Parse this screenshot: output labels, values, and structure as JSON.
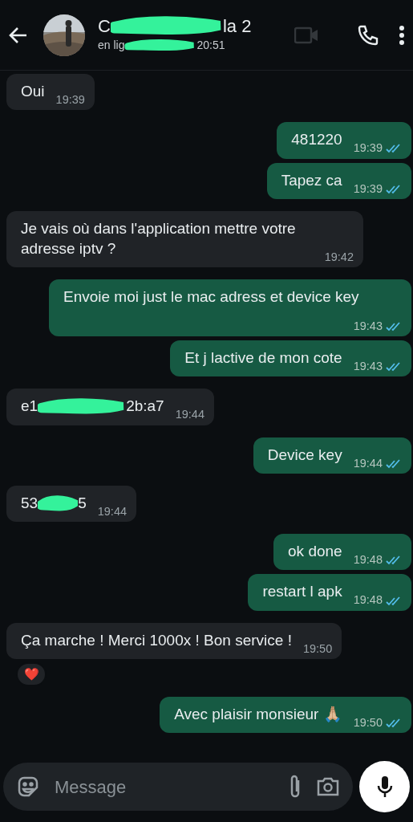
{
  "header": {
    "name_start": "C",
    "name_end": "la 2",
    "status_start": "en lig",
    "status_end": "20:51",
    "video_call_disabled": true
  },
  "messages": [
    {
      "outgoing": false,
      "text": "Oui",
      "time": "19:39"
    },
    {
      "outgoing": true,
      "text": "481220",
      "time": "19:39",
      "read": true
    },
    {
      "outgoing": true,
      "text": "Tapez ca",
      "time": "19:39",
      "read": true
    },
    {
      "outgoing": false,
      "text": "Je vais où dans l'application mettre votre adresse iptv ?",
      "time": "19:42"
    },
    {
      "outgoing": true,
      "text": "Envoie moi just le mac adress et device key",
      "time": "19:43",
      "read": true
    },
    {
      "outgoing": true,
      "text": "Et j lactive de mon cote",
      "time": "19:43",
      "read": true
    },
    {
      "outgoing": false,
      "text": "e1",
      "text_end": "2b:a7",
      "redacted": true,
      "time": "19:44"
    },
    {
      "outgoing": true,
      "text": "Device key",
      "time": "19:44",
      "read": true
    },
    {
      "outgoing": false,
      "text": "53",
      "text_end": "5",
      "redacted": true,
      "time": "19:44"
    },
    {
      "outgoing": true,
      "text": "ok done",
      "time": "19:48",
      "read": true
    },
    {
      "outgoing": true,
      "text": "restart l apk",
      "time": "19:48",
      "read": true
    },
    {
      "outgoing": false,
      "text": "Ça marche ! Merci 1000x ! Bon service !",
      "time": "19:50",
      "reaction": "❤️"
    },
    {
      "outgoing": true,
      "text": "Avec plaisir monsieur 🙏🏼",
      "time": "19:50",
      "read": true
    }
  ],
  "composer": {
    "placeholder": "Message"
  }
}
